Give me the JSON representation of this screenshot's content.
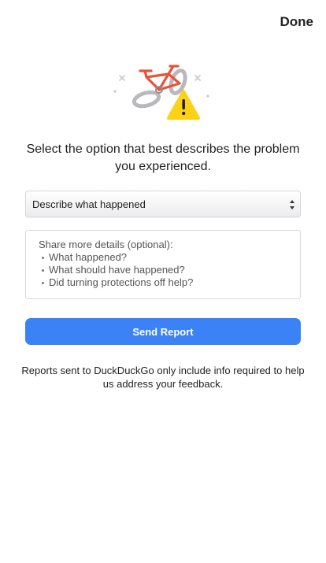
{
  "header": {
    "done_label": "Done"
  },
  "illustration": {
    "icon": "broken-bike-warning-icon"
  },
  "prompt": "Select the option that best describes the problem you experienced.",
  "category_select": {
    "value": "Describe what happened"
  },
  "details": {
    "heading": "Share more details (optional):",
    "bullets": [
      "What happened?",
      "What should have happened?",
      "Did turning protections off help?"
    ]
  },
  "send_label": "Send Report",
  "footer_note": "Reports sent to DuckDuckGo only include info required to help us address your feedback.",
  "colors": {
    "accent": "#3b82f6",
    "warning": "#fcd116",
    "bike": "#e8533a"
  }
}
